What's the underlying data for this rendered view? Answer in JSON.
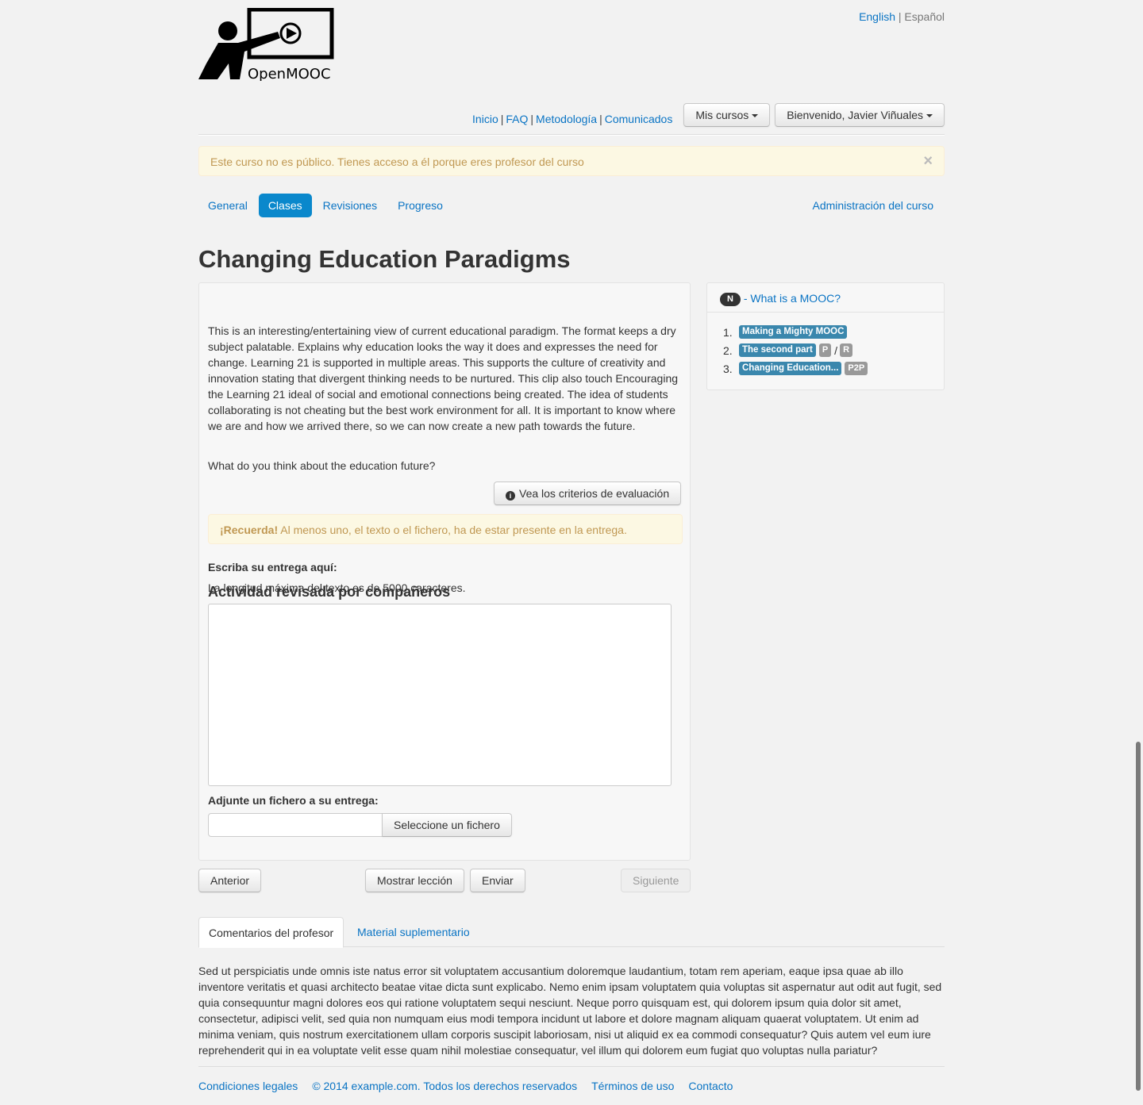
{
  "header": {
    "logo_text": "OpenMOOC",
    "languages": {
      "active": "English",
      "separator": "|",
      "inactive": "Español"
    },
    "nav_links": [
      "Inicio",
      "FAQ",
      "Metodología",
      "Comunicados"
    ],
    "nav_separator": "|",
    "my_courses_label": "Mis cursos",
    "user_menu_label": "Bienvenido, Javier Viñuales"
  },
  "alert": {
    "text": "Este curso no es público. Tienes acceso a él porque eres profesor del curso",
    "close": "×"
  },
  "course_tabs": {
    "items": [
      "General",
      "Clases",
      "Revisiones",
      "Progreso"
    ],
    "active": "Clases",
    "admin_link": "Administración del curso"
  },
  "page_title": "Changing Education Paradigms",
  "activity": {
    "title": "Actividad revisada por compañeros",
    "description": "This is an interesting/entertaining view of current educational paradigm. The format keeps a dry subject palatable. Explains why education looks the way it does and expresses the need for change. Learning 21 is supported in multiple areas. This supports the culture of creativity and innovation stating that divergent thinking needs to be nurtured. This clip also touch Encouraging the Learning 21 ideal of social and emotional connections being created. The idea of students collaborating is not cheating but the best work environment for all. It is important to know where we are and how we arrived there, so we can now create a new path towards the future.",
    "question": "What do you think about the education future?",
    "criteria_button": "Vea los criterios de evaluación",
    "criteria_icon": "info-icon",
    "reminder_strong": "¡Recuerda!",
    "reminder_text": " Al menos uno, el texto o el fichero, ha de estar presente en la entrega.",
    "text_label": "Escriba su entrega aquí:",
    "max_length_text": "La longitud máxima del texto es de 5000 caracteres.",
    "textarea_value": "",
    "file_label": "Adjunte un fichero a su entrega:",
    "file_value": "",
    "file_button": "Seleccione un fichero"
  },
  "actions": {
    "previous": "Anterior",
    "show_lesson": "Mostrar lección",
    "submit": "Enviar",
    "next": "Siguiente"
  },
  "sidebar": {
    "badge": "N",
    "unit_title": "- What is a MOOC?",
    "lessons": [
      {
        "num": "1.",
        "label": "Making a Mighty MOOC",
        "tags": []
      },
      {
        "num": "2.",
        "label": "The second part",
        "tags": [
          "P",
          "R"
        ]
      },
      {
        "num": "3.",
        "label": "Changing Education...",
        "tags": [
          "P2P"
        ]
      }
    ],
    "tag_separator": "/"
  },
  "bottom_tabs": {
    "items": [
      "Comentarios del profesor",
      "Material suplementario"
    ],
    "active": "Comentarios del profesor"
  },
  "comments": "Sed ut perspiciatis unde omnis iste natus error sit voluptatem accusantium doloremque laudantium, totam rem aperiam, eaque ipsa quae ab illo inventore veritatis et quasi architecto beatae vitae dicta sunt explicabo. Nemo enim ipsam voluptatem quia voluptas sit aspernatur aut odit aut fugit, sed quia consequuntur magni dolores eos qui ratione voluptatem sequi nesciunt. Neque porro quisquam est, qui dolorem ipsum quia dolor sit amet, consectetur, adipisci velit, sed quia non numquam eius modi tempora incidunt ut labore et dolore magnam aliquam quaerat voluptatem. Ut enim ad minima veniam, quis nostrum exercitationem ullam corporis suscipit laboriosam, nisi ut aliquid ex ea commodi consequatur? Quis autem vel eum iure reprehenderit qui in ea voluptate velit esse quam nihil molestiae consequatur, vel illum qui dolorem eum fugiat quo voluptas nulla pariatur?",
  "footer": {
    "links": [
      "Condiciones legales",
      "© 2014 example.com. Todos los derechos reservados",
      "Términos de uso",
      "Contacto"
    ]
  },
  "colors": {
    "link": "#0a74c4",
    "active_tab": "#0a88cc",
    "warning_bg": "#fcf8e3",
    "warning_text": "#c09853",
    "lesson_label": "#3a87ad",
    "tag_grey": "#999999"
  }
}
